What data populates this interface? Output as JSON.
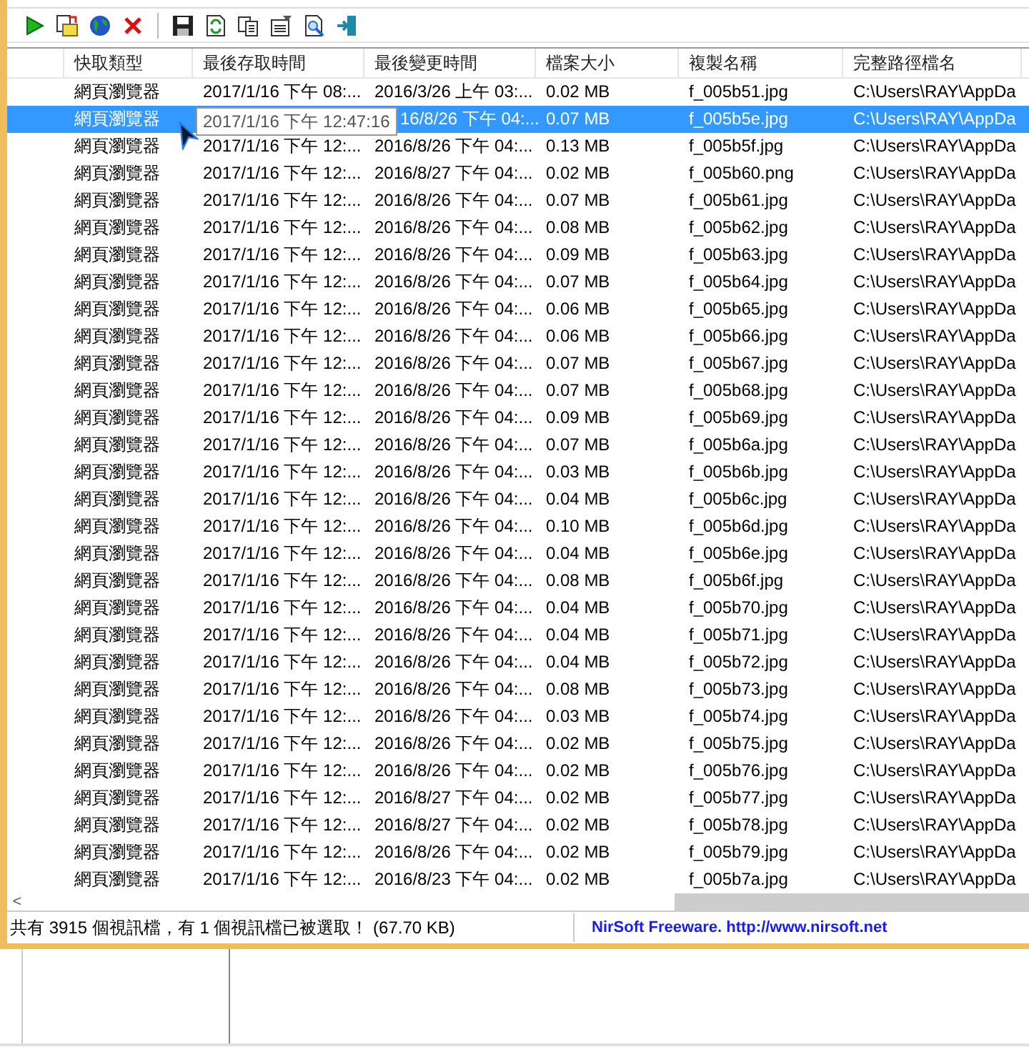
{
  "toolbar": [
    {
      "kind": "play"
    },
    {
      "kind": "open"
    },
    {
      "kind": "globe"
    },
    {
      "kind": "delete"
    },
    {
      "kind": "sep"
    },
    {
      "kind": "save"
    },
    {
      "kind": "refresh"
    },
    {
      "kind": "copy"
    },
    {
      "kind": "properties"
    },
    {
      "kind": "find"
    },
    {
      "kind": "exit"
    }
  ],
  "table": {
    "columns": [
      "快取類型",
      "最後存取時間",
      "最後變更時間",
      "檔案大小",
      "複製名稱",
      "完整路徑檔名"
    ],
    "rows": [
      {
        "type": "網頁瀏覽器",
        "accessed": "2017/1/16 下午 08:...",
        "modified": "2016/3/26 上午 03:...",
        "size": "0.02 MB",
        "name": "f_005b51.jpg",
        "path": "C:\\Users\\RAY\\AppDa",
        "selected": false
      },
      {
        "type": "網頁瀏覽器",
        "tooltip": "2017/1/16 下午 12:47:16",
        "modified": "16/8/26 下午 04:...",
        "size": "0.07 MB",
        "name": "f_005b5e.jpg",
        "path": "C:\\Users\\RAY\\AppDa",
        "selected": true
      },
      {
        "type": "網頁瀏覽器",
        "accessed": "2017/1/16 下午 12:...",
        "modified": "2016/8/26 下午 04:...",
        "size": "0.13 MB",
        "name": "f_005b5f.jpg",
        "path": "C:\\Users\\RAY\\AppDa",
        "selected": false
      },
      {
        "type": "網頁瀏覽器",
        "accessed": "2017/1/16 下午 12:...",
        "modified": "2016/8/27 下午 04:...",
        "size": "0.02 MB",
        "name": "f_005b60.png",
        "path": "C:\\Users\\RAY\\AppDa",
        "selected": false
      },
      {
        "type": "網頁瀏覽器",
        "accessed": "2017/1/16 下午 12:...",
        "modified": "2016/8/26 下午 04:...",
        "size": "0.07 MB",
        "name": "f_005b61.jpg",
        "path": "C:\\Users\\RAY\\AppDa",
        "selected": false
      },
      {
        "type": "網頁瀏覽器",
        "accessed": "2017/1/16 下午 12:...",
        "modified": "2016/8/26 下午 04:...",
        "size": "0.08 MB",
        "name": "f_005b62.jpg",
        "path": "C:\\Users\\RAY\\AppDa",
        "selected": false
      },
      {
        "type": "網頁瀏覽器",
        "accessed": "2017/1/16 下午 12:...",
        "modified": "2016/8/26 下午 04:...",
        "size": "0.09 MB",
        "name": "f_005b63.jpg",
        "path": "C:\\Users\\RAY\\AppDa",
        "selected": false
      },
      {
        "type": "網頁瀏覽器",
        "accessed": "2017/1/16 下午 12:...",
        "modified": "2016/8/26 下午 04:...",
        "size": "0.07 MB",
        "name": "f_005b64.jpg",
        "path": "C:\\Users\\RAY\\AppDa",
        "selected": false
      },
      {
        "type": "網頁瀏覽器",
        "accessed": "2017/1/16 下午 12:...",
        "modified": "2016/8/26 下午 04:...",
        "size": "0.06 MB",
        "name": "f_005b65.jpg",
        "path": "C:\\Users\\RAY\\AppDa",
        "selected": false
      },
      {
        "type": "網頁瀏覽器",
        "accessed": "2017/1/16 下午 12:...",
        "modified": "2016/8/26 下午 04:...",
        "size": "0.06 MB",
        "name": "f_005b66.jpg",
        "path": "C:\\Users\\RAY\\AppDa",
        "selected": false
      },
      {
        "type": "網頁瀏覽器",
        "accessed": "2017/1/16 下午 12:...",
        "modified": "2016/8/26 下午 04:...",
        "size": "0.07 MB",
        "name": "f_005b67.jpg",
        "path": "C:\\Users\\RAY\\AppDa",
        "selected": false
      },
      {
        "type": "網頁瀏覽器",
        "accessed": "2017/1/16 下午 12:...",
        "modified": "2016/8/26 下午 04:...",
        "size": "0.07 MB",
        "name": "f_005b68.jpg",
        "path": "C:\\Users\\RAY\\AppDa",
        "selected": false
      },
      {
        "type": "網頁瀏覽器",
        "accessed": "2017/1/16 下午 12:...",
        "modified": "2016/8/26 下午 04:...",
        "size": "0.09 MB",
        "name": "f_005b69.jpg",
        "path": "C:\\Users\\RAY\\AppDa",
        "selected": false
      },
      {
        "type": "網頁瀏覽器",
        "accessed": "2017/1/16 下午 12:...",
        "modified": "2016/8/26 下午 04:...",
        "size": "0.07 MB",
        "name": "f_005b6a.jpg",
        "path": "C:\\Users\\RAY\\AppDa",
        "selected": false
      },
      {
        "type": "網頁瀏覽器",
        "accessed": "2017/1/16 下午 12:...",
        "modified": "2016/8/26 下午 04:...",
        "size": "0.03 MB",
        "name": "f_005b6b.jpg",
        "path": "C:\\Users\\RAY\\AppDa",
        "selected": false
      },
      {
        "type": "網頁瀏覽器",
        "accessed": "2017/1/16 下午 12:...",
        "modified": "2016/8/26 下午 04:...",
        "size": "0.04 MB",
        "name": "f_005b6c.jpg",
        "path": "C:\\Users\\RAY\\AppDa",
        "selected": false
      },
      {
        "type": "網頁瀏覽器",
        "accessed": "2017/1/16 下午 12:...",
        "modified": "2016/8/26 下午 04:...",
        "size": "0.10 MB",
        "name": "f_005b6d.jpg",
        "path": "C:\\Users\\RAY\\AppDa",
        "selected": false
      },
      {
        "type": "網頁瀏覽器",
        "accessed": "2017/1/16 下午 12:...",
        "modified": "2016/8/26 下午 04:...",
        "size": "0.04 MB",
        "name": "f_005b6e.jpg",
        "path": "C:\\Users\\RAY\\AppDa",
        "selected": false
      },
      {
        "type": "網頁瀏覽器",
        "accessed": "2017/1/16 下午 12:...",
        "modified": "2016/8/26 下午 04:...",
        "size": "0.08 MB",
        "name": "f_005b6f.jpg",
        "path": "C:\\Users\\RAY\\AppDa",
        "selected": false
      },
      {
        "type": "網頁瀏覽器",
        "accessed": "2017/1/16 下午 12:...",
        "modified": "2016/8/26 下午 04:...",
        "size": "0.04 MB",
        "name": "f_005b70.jpg",
        "path": "C:\\Users\\RAY\\AppDa",
        "selected": false
      },
      {
        "type": "網頁瀏覽器",
        "accessed": "2017/1/16 下午 12:...",
        "modified": "2016/8/26 下午 04:...",
        "size": "0.04 MB",
        "name": "f_005b71.jpg",
        "path": "C:\\Users\\RAY\\AppDa",
        "selected": false
      },
      {
        "type": "網頁瀏覽器",
        "accessed": "2017/1/16 下午 12:...",
        "modified": "2016/8/26 下午 04:...",
        "size": "0.04 MB",
        "name": "f_005b72.jpg",
        "path": "C:\\Users\\RAY\\AppDa",
        "selected": false
      },
      {
        "type": "網頁瀏覽器",
        "accessed": "2017/1/16 下午 12:...",
        "modified": "2016/8/26 下午 04:...",
        "size": "0.08 MB",
        "name": "f_005b73.jpg",
        "path": "C:\\Users\\RAY\\AppDa",
        "selected": false
      },
      {
        "type": "網頁瀏覽器",
        "accessed": "2017/1/16 下午 12:...",
        "modified": "2016/8/26 下午 04:...",
        "size": "0.03 MB",
        "name": "f_005b74.jpg",
        "path": "C:\\Users\\RAY\\AppDa",
        "selected": false
      },
      {
        "type": "網頁瀏覽器",
        "accessed": "2017/1/16 下午 12:...",
        "modified": "2016/8/26 下午 04:...",
        "size": "0.02 MB",
        "name": "f_005b75.jpg",
        "path": "C:\\Users\\RAY\\AppDa",
        "selected": false
      },
      {
        "type": "網頁瀏覽器",
        "accessed": "2017/1/16 下午 12:...",
        "modified": "2016/8/26 下午 04:...",
        "size": "0.02 MB",
        "name": "f_005b76.jpg",
        "path": "C:\\Users\\RAY\\AppDa",
        "selected": false
      },
      {
        "type": "網頁瀏覽器",
        "accessed": "2017/1/16 下午 12:...",
        "modified": "2016/8/27 下午 04:...",
        "size": "0.02 MB",
        "name": "f_005b77.jpg",
        "path": "C:\\Users\\RAY\\AppDa",
        "selected": false
      },
      {
        "type": "網頁瀏覽器",
        "accessed": "2017/1/16 下午 12:...",
        "modified": "2016/8/27 下午 04:...",
        "size": "0.02 MB",
        "name": "f_005b78.jpg",
        "path": "C:\\Users\\RAY\\AppDa",
        "selected": false
      },
      {
        "type": "網頁瀏覽器",
        "accessed": "2017/1/16 下午 12:...",
        "modified": "2016/8/26 下午 04:...",
        "size": "0.02 MB",
        "name": "f_005b79.jpg",
        "path": "C:\\Users\\RAY\\AppDa",
        "selected": false
      },
      {
        "type": "網頁瀏覽器",
        "accessed": "2017/1/16 下午 12:...",
        "modified": "2016/8/23 下午 04:...",
        "size": "0.02 MB",
        "name": "f_005b7a.jpg",
        "path": "C:\\Users\\RAY\\AppDa",
        "selected": false
      }
    ]
  },
  "scroll_left": "<",
  "status_bar": {
    "text": "共有 3915 個視訊檔，有 1 個視訊檔已被選取！  (67.70 KB)",
    "link": "NirSoft Freeware.  http://www.nirsoft.net"
  }
}
